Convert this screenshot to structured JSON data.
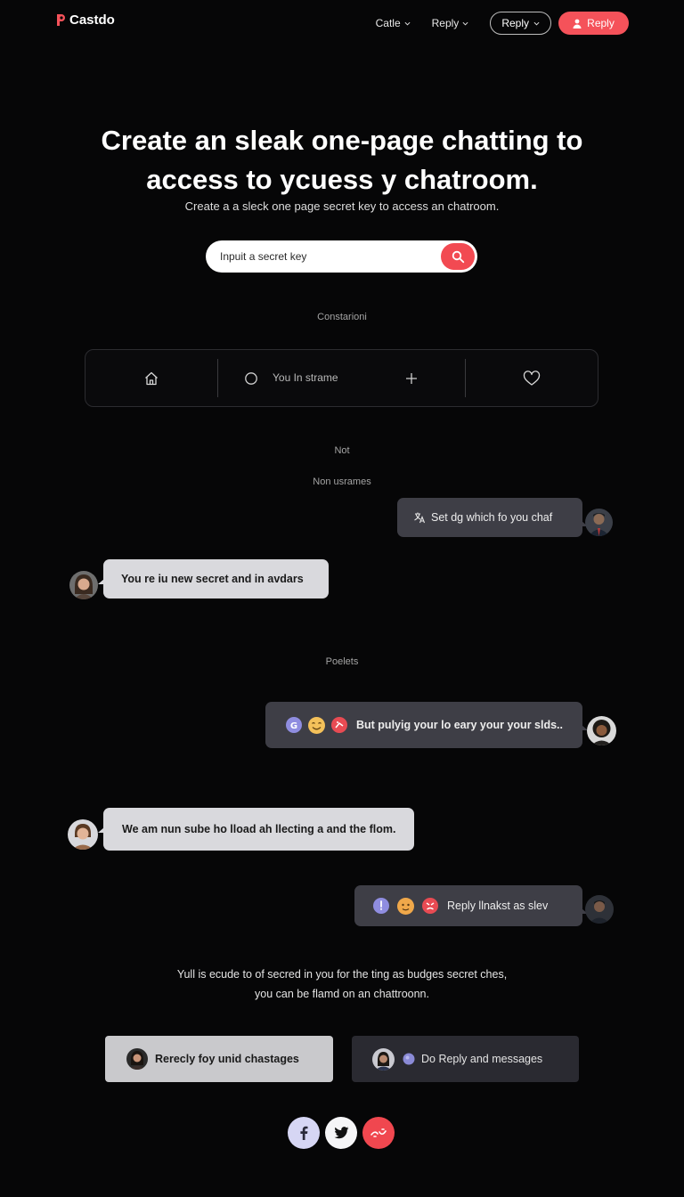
{
  "header": {
    "brand": "Castdo",
    "nav": [
      {
        "label": "Catle"
      },
      {
        "label": "Reply"
      }
    ],
    "outline_button": "Reply",
    "primary_button": "Reply"
  },
  "hero": {
    "title_line1": "Create an sleak one-page chatting to",
    "title_line2": "access to ycuess y chatroom.",
    "subtitle": "Create a a sleck one page secret key to access  an chatroom."
  },
  "search": {
    "placeholder": "Inpuit a secret key"
  },
  "sections": {
    "constarions": "Constarioni",
    "not": "Not",
    "usernames": "Non usrames",
    "posts": "Poelets"
  },
  "toolbar": {
    "status_text": "You In strame"
  },
  "messages": [
    {
      "text": "Set dg which fo you chaf"
    },
    {
      "text": "You re iu new secret and in avdars"
    },
    {
      "text": "But pulyig your lo eary your your slds.."
    },
    {
      "text": "We am nun sube ho lload ah llecting a and the flom."
    },
    {
      "text": "Reply llnakst as slev"
    }
  ],
  "footer": {
    "line1": "Yull is ecude to of secred in you for the ting as budges secret ches,",
    "line2": "you can be flamd on an chattroonn."
  },
  "cards": [
    {
      "label": "Rerecly foy unid chastages"
    },
    {
      "label": "Do Reply and messages"
    }
  ],
  "colors": {
    "accent": "#f5525a",
    "background": "#060607",
    "bubble_light": "#d9d9dd",
    "bubble_dark": "#3e3e46"
  }
}
